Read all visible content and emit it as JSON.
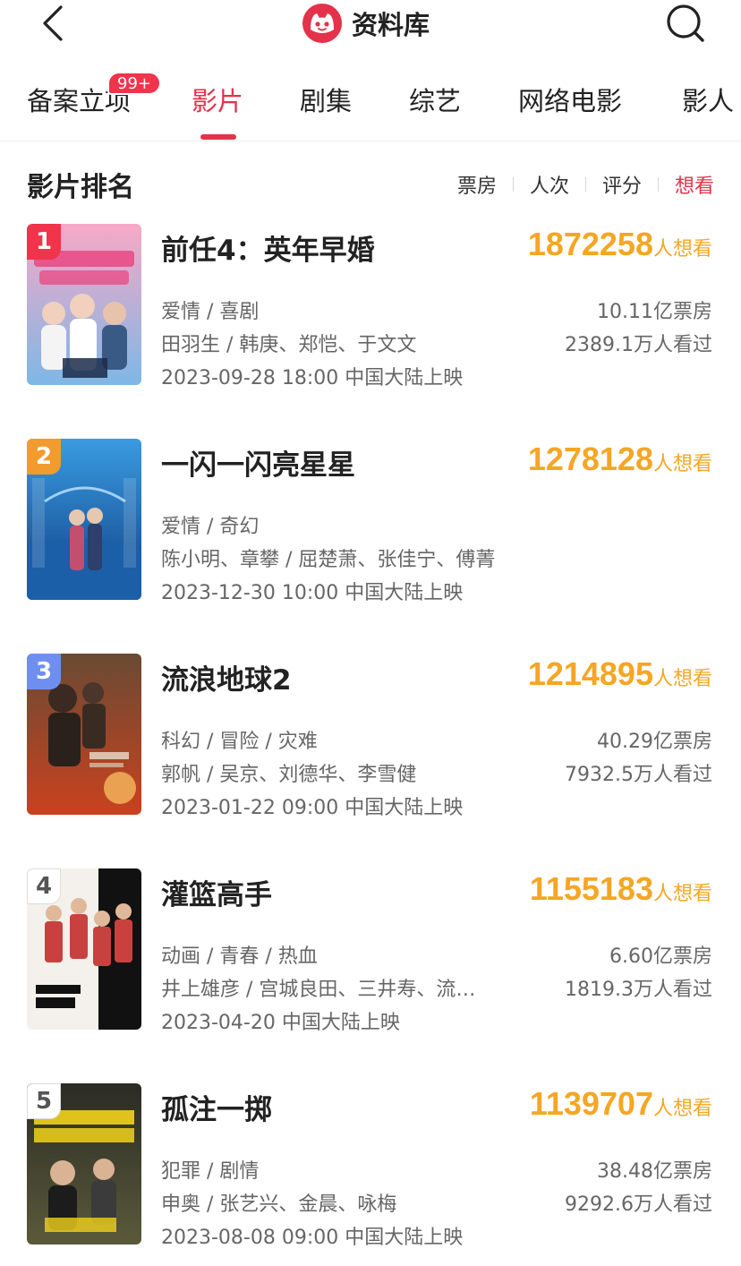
{
  "header": {
    "title": "资料库"
  },
  "tabs": [
    {
      "label": "备案立项",
      "badge": "99+"
    },
    {
      "label": "影片"
    },
    {
      "label": "剧集"
    },
    {
      "label": "综艺"
    },
    {
      "label": "网络电影"
    },
    {
      "label": "影人"
    }
  ],
  "active_tab": "影片",
  "section": {
    "title": "影片排名",
    "sort_options": [
      "票房",
      "人次",
      "评分",
      "想看"
    ],
    "active_sort": "想看"
  },
  "colors": {
    "accent": "#e3324a",
    "want_orange": "#f5a623",
    "rank1": "#f0344b",
    "rank2": "#f29b2e",
    "rank3": "#6f8ff0",
    "rank_other": "#cfcfcf"
  },
  "films": [
    {
      "rank": "1",
      "title": "前任4：英年早婚",
      "want_count": "1872258",
      "want_unit": "人想看",
      "genre": "爱情 / 喜剧",
      "cast": "田羽生 / 韩庚、郑恺、于文文",
      "release": "2023-09-28 18:00 中国大陆上映",
      "box_office": "10.11亿票房",
      "viewers": "2389.1万人看过"
    },
    {
      "rank": "2",
      "title": "一闪一闪亮星星",
      "want_count": "1278128",
      "want_unit": "人想看",
      "genre": "爱情 / 奇幻",
      "cast": "陈小明、章攀 / 屈楚萧、张佳宁、傅菁",
      "release": "2023-12-30 10:00 中国大陆上映",
      "box_office": "",
      "viewers": ""
    },
    {
      "rank": "3",
      "title": "流浪地球2",
      "want_count": "1214895",
      "want_unit": "人想看",
      "genre": "科幻 / 冒险 / 灾难",
      "cast": "郭帆 / 吴京、刘德华、李雪健",
      "release": "2023-01-22 09:00 中国大陆上映",
      "box_office": "40.29亿票房",
      "viewers": "7932.5万人看过"
    },
    {
      "rank": "4",
      "title": "灌篮高手",
      "want_count": "1155183",
      "want_unit": "人想看",
      "genre": "动画 / 青春 / 热血",
      "cast": "井上雄彦 / 宫城良田、三井寿、流…",
      "release": "2023-04-20 中国大陆上映",
      "box_office": "6.60亿票房",
      "viewers": "1819.3万人看过"
    },
    {
      "rank": "5",
      "title": "孤注一掷",
      "want_count": "1139707",
      "want_unit": "人想看",
      "genre": "犯罪 / 剧情",
      "cast": "申奥 / 张艺兴、金晨、咏梅",
      "release": "2023-08-08 09:00 中国大陆上映",
      "box_office": "38.48亿票房",
      "viewers": "9292.6万人看过"
    }
  ]
}
